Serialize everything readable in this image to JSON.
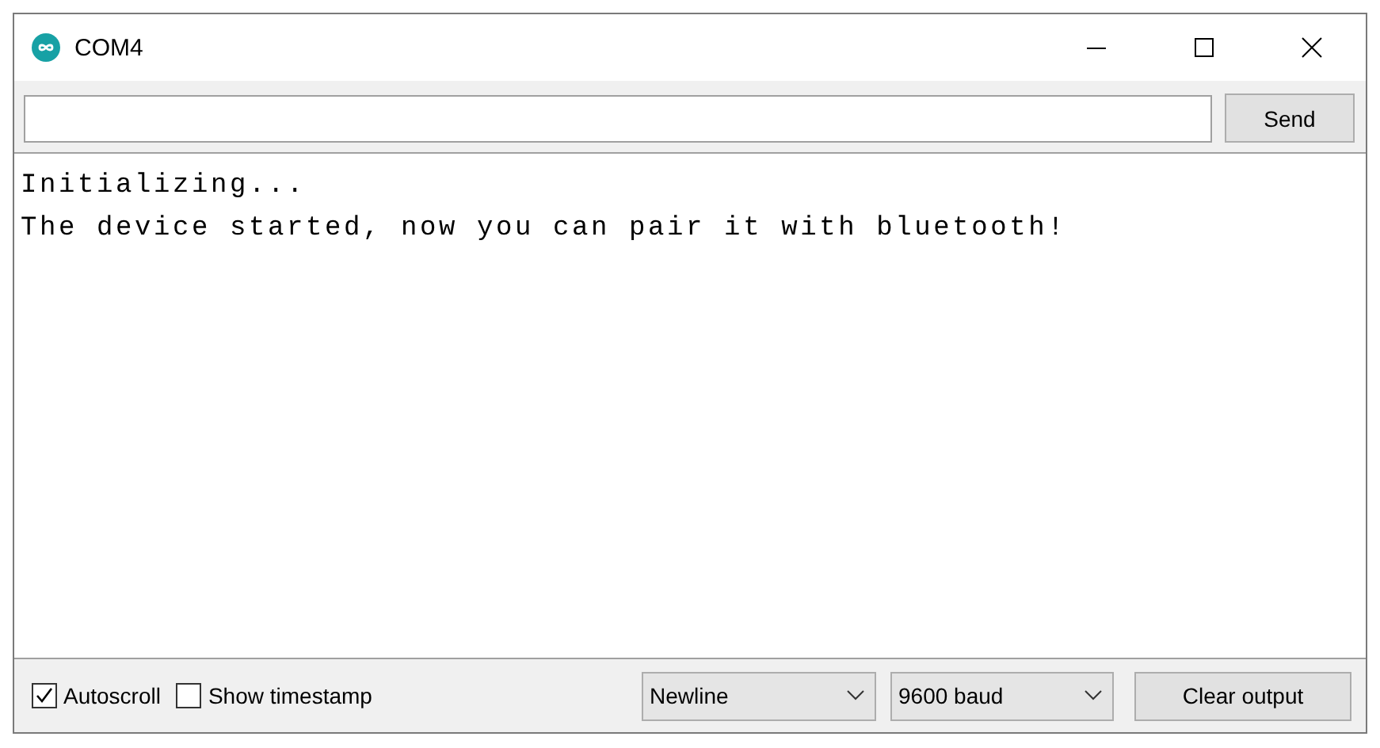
{
  "window": {
    "title": "COM4"
  },
  "input": {
    "button": "Send"
  },
  "output": {
    "lines": [
      "Initializing...",
      "The device started, now you can pair it with bluetooth!"
    ]
  },
  "footer": {
    "checkboxes": [
      {
        "label": "Autoscroll",
        "checked": true
      },
      {
        "label": "Show timestamp",
        "checked": false
      }
    ],
    "dropdowns": [
      {
        "value": "Newline"
      },
      {
        "value": "9600 baud"
      }
    ],
    "button": "Clear output"
  }
}
